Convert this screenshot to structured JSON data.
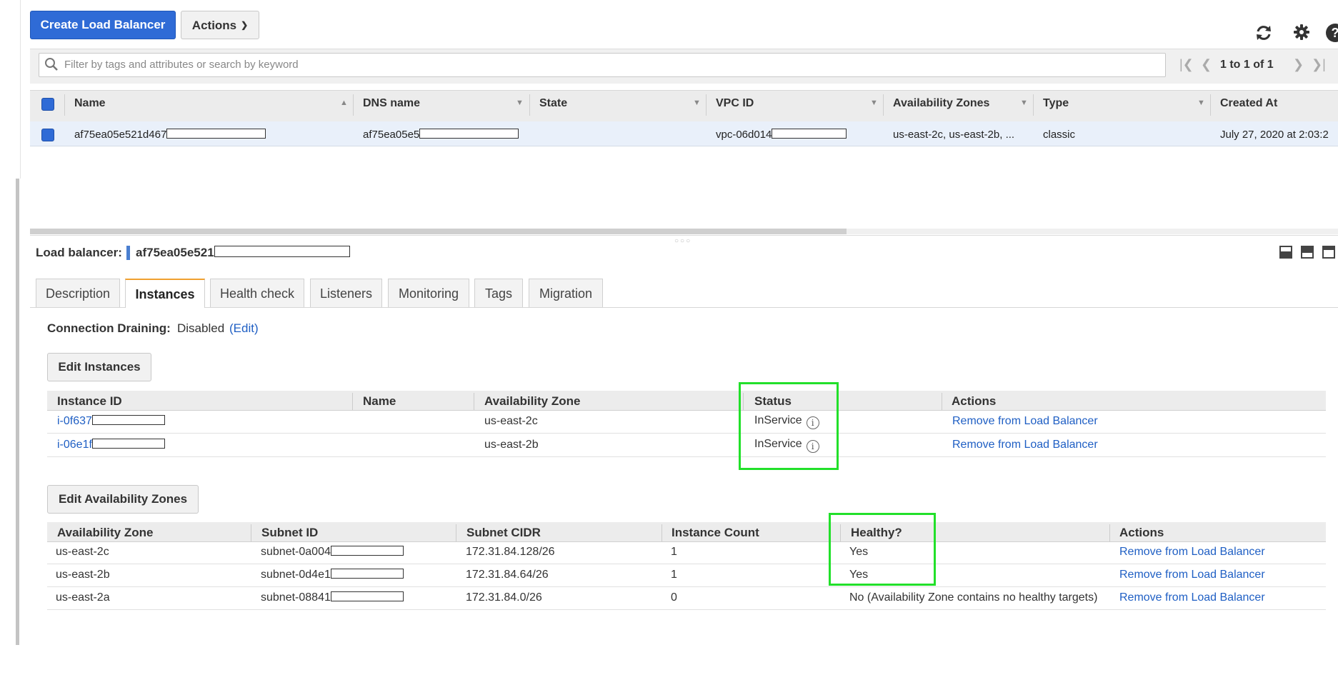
{
  "toolbar": {
    "create_label": "Create Load Balancer",
    "actions_label": "Actions",
    "refresh_icon": "refresh-icon",
    "settings_icon": "gear-icon",
    "help_icon": "help-icon"
  },
  "filter": {
    "placeholder": "Filter by tags and attributes or search by keyword",
    "pager_text": "1 to 1 of 1"
  },
  "grid": {
    "columns": [
      "Name",
      "DNS name",
      "State",
      "VPC ID",
      "Availability Zones",
      "Type",
      "Created At"
    ],
    "row": {
      "name": "af75ea05e521d467",
      "dns": "af75ea05e5",
      "state": "",
      "vpc": "vpc-06d014",
      "zones": "us-east-2c, us-east-2b, ...",
      "type": "classic",
      "created": "July 27, 2020 at 2:03:2"
    }
  },
  "detail": {
    "label": "Load balancer:",
    "value": "af75ea05e521",
    "tabs": [
      "Description",
      "Instances",
      "Health check",
      "Listeners",
      "Monitoring",
      "Tags",
      "Migration"
    ],
    "active_tab": "Instances",
    "draining_label": "Connection Draining:",
    "draining_value": "Disabled",
    "draining_edit": "(Edit)"
  },
  "instances": {
    "button": "Edit Instances",
    "columns": [
      "Instance ID",
      "Name",
      "Availability Zone",
      "Status",
      "Actions"
    ],
    "rows": [
      {
        "id": "i-0f637",
        "name": "",
        "zone": "us-east-2c",
        "status": "InService",
        "action": "Remove from Load Balancer"
      },
      {
        "id": "i-06e1f",
        "name": "",
        "zone": "us-east-2b",
        "status": "InService",
        "action": "Remove from Load Balancer"
      }
    ]
  },
  "zones": {
    "button": "Edit Availability Zones",
    "columns": [
      "Availability Zone",
      "Subnet ID",
      "Subnet CIDR",
      "Instance Count",
      "Healthy?",
      "Actions"
    ],
    "rows": [
      {
        "zone": "us-east-2c",
        "subnet": "subnet-0a004",
        "cidr": "172.31.84.128/26",
        "count": "1",
        "healthy": "Yes",
        "action": "Remove from Load Balancer"
      },
      {
        "zone": "us-east-2b",
        "subnet": "subnet-0d4e1",
        "cidr": "172.31.84.64/26",
        "count": "1",
        "healthy": "Yes",
        "action": "Remove from Load Balancer"
      },
      {
        "zone": "us-east-2a",
        "subnet": "subnet-08841",
        "cidr": "172.31.84.0/26",
        "count": "0",
        "healthy": "No (Availability Zone contains no healthy targets)",
        "action": "Remove from Load Balancer"
      }
    ]
  },
  "colors": {
    "primary": "#2f6bd6",
    "link": "#1f5fc4",
    "highlight": "#22e02a",
    "tab_accent": "#f0a030"
  }
}
